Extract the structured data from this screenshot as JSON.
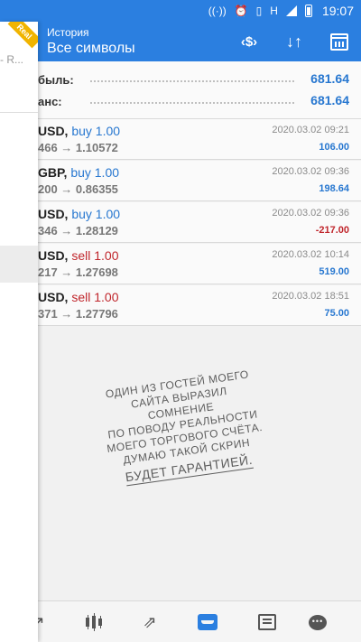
{
  "status_bar": {
    "time": "19:07",
    "network": "H"
  },
  "toolbar": {
    "subtitle": "История",
    "title": "Все символы"
  },
  "summary": {
    "profit_label": "быль:",
    "profit_value": "681.64",
    "balance_label": "анс:",
    "balance_value": "681.64"
  },
  "deals": [
    {
      "symbol": "USD, ",
      "type": "buy 1.00",
      "prices": "466 → 1.10572",
      "date": "2020.03.02 09:21",
      "profit": "106.00"
    },
    {
      "symbol": "GBP, ",
      "type": "buy 1.00",
      "prices": "200 → 0.86355",
      "date": "2020.03.02 09:36",
      "profit": "198.64"
    },
    {
      "symbol": "USD, ",
      "type": "buy 1.00",
      "prices": "346 → 1.28129",
      "date": "2020.03.02 09:36",
      "profit": "-217.00"
    },
    {
      "symbol": "USD, ",
      "type": "sell 1.00",
      "prices": "217 → 1.27698",
      "date": "2020.03.02 10:14",
      "profit": "519.00"
    },
    {
      "symbol": "USD, ",
      "type": "sell 1.00",
      "prices": "371 → 1.27796",
      "date": "2020.03.02 18:51",
      "profit": "75.00"
    }
  ],
  "caption": {
    "line1": "Один из гостей моего",
    "line2": "сайта выразил сомнение",
    "line3": "по поводу реальности",
    "line4": "моего торгового счёта.",
    "line5": "Думаю такой скрин",
    "line6": "будет гарантией."
  },
  "drawer": {
    "account_text": "- R...",
    "badge": "Real"
  },
  "colors": {
    "accent": "#2b7fe0",
    "buy": "#2777d0",
    "sell": "#c0262c"
  },
  "icons": {
    "toolbar": [
      "symbols-icon",
      "sort-icon",
      "calendar-icon"
    ],
    "nav": [
      "quotes-icon",
      "chart-icon",
      "trade-icon",
      "history-icon",
      "news-icon",
      "chat-icon"
    ]
  }
}
